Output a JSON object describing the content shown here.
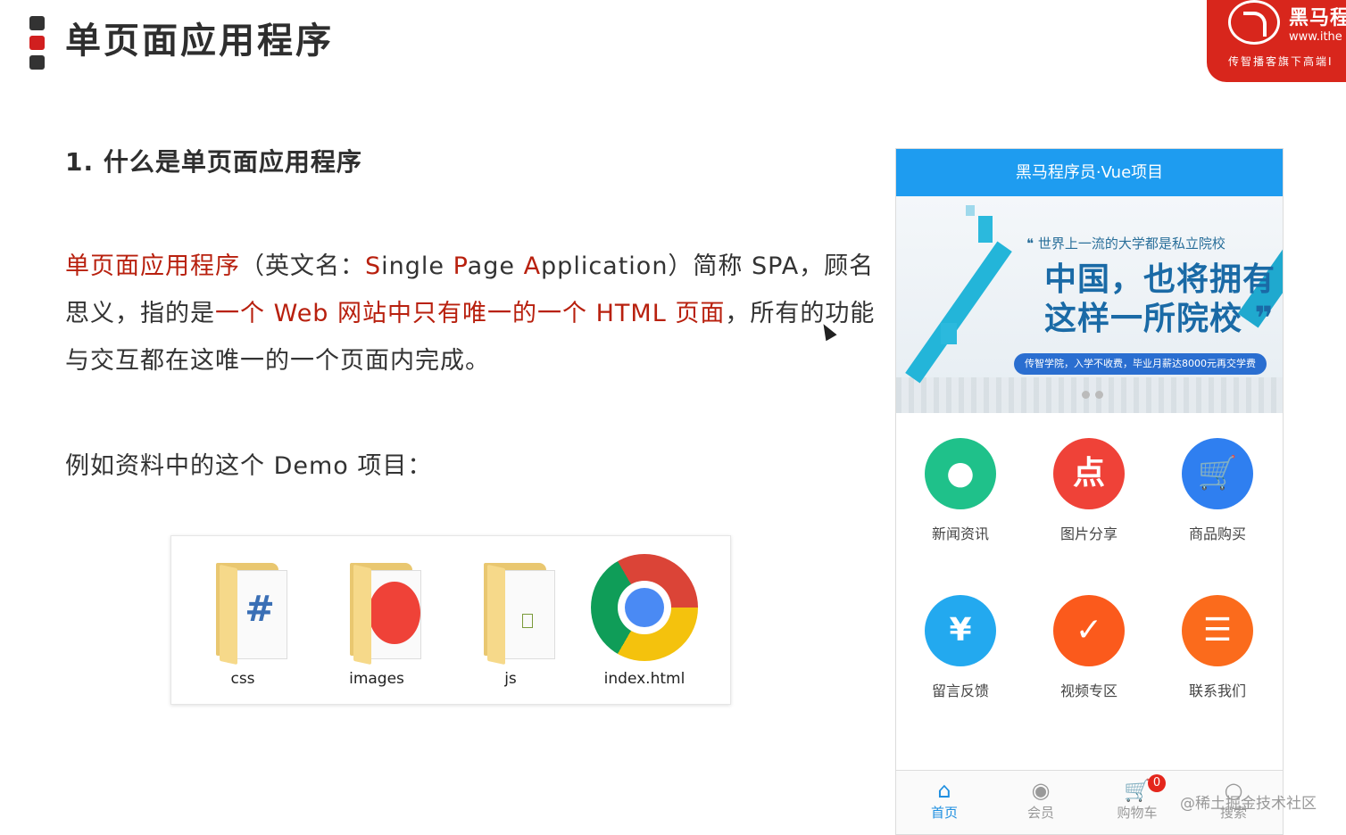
{
  "slide": {
    "title": "单页面应用程序",
    "section_heading": "1. 什么是单页面应用程序",
    "para_1_hl": "单页面应用程序",
    "para_2": "（英文名：",
    "para_3_hl": "S",
    "para_4": "ingle ",
    "para_5_hl": "P",
    "para_6": "age ",
    "para_7_hl": "A",
    "para_8": "pplication）简称 SPA，顾名思义，指的是",
    "para_9_hl": "一个 Web 网站中只有唯一的一个 HTML 页面",
    "para_10": "，所有的功能与交互都在这唯一的一个页面内完成。",
    "example_label": "例如资料中的这个 Demo 项目："
  },
  "brand": {
    "name": "黑马程",
    "url": "www.ithe",
    "tagline": "传智播客旗下高端I"
  },
  "files": [
    {
      "label": "css"
    },
    {
      "label": "images"
    },
    {
      "label": "js"
    },
    {
      "label": "index.html"
    }
  ],
  "phone": {
    "header_title": "黑马程序员·Vue项目",
    "banner": {
      "quote": "❝ 世界上一流的大学都是私立院校",
      "line1": "中国，也将拥有",
      "line2": "这样一所院校 ❞",
      "pill": "传智学院，入学不收费，毕业月薪达8000元再交学费"
    },
    "tiles": [
      {
        "label": "新闻资讯",
        "color": "#1fc18a",
        "icon": "location-pin-icon",
        "glyph": "●"
      },
      {
        "label": "图片分享",
        "color": "#ef4238",
        "icon": "dianping-icon",
        "glyph": "点"
      },
      {
        "label": "商品购买",
        "color": "#2f7ff0",
        "icon": "shopping-cart-icon",
        "glyph": "🛒"
      },
      {
        "label": "留言反馈",
        "color": "#23a9ef",
        "icon": "yen-phone-icon",
        "glyph": "¥"
      },
      {
        "label": "视频专区",
        "color": "#fb5a1c",
        "icon": "check-shield-icon",
        "glyph": "✓"
      },
      {
        "label": "联系我们",
        "color": "#fb6b1c",
        "icon": "list-icon",
        "glyph": "☰"
      }
    ],
    "tabs": [
      {
        "label": "首页",
        "icon": "home-icon",
        "glyph": "⌂",
        "active": true
      },
      {
        "label": "会员",
        "icon": "user-icon",
        "glyph": "◉",
        "active": false
      },
      {
        "label": "购物车",
        "icon": "cart-icon",
        "glyph": "🛒",
        "active": false,
        "badge": "0"
      },
      {
        "label": "搜索",
        "icon": "search-icon",
        "glyph": "○",
        "active": false
      }
    ]
  },
  "watermark": "@稀土掘金技术社区"
}
